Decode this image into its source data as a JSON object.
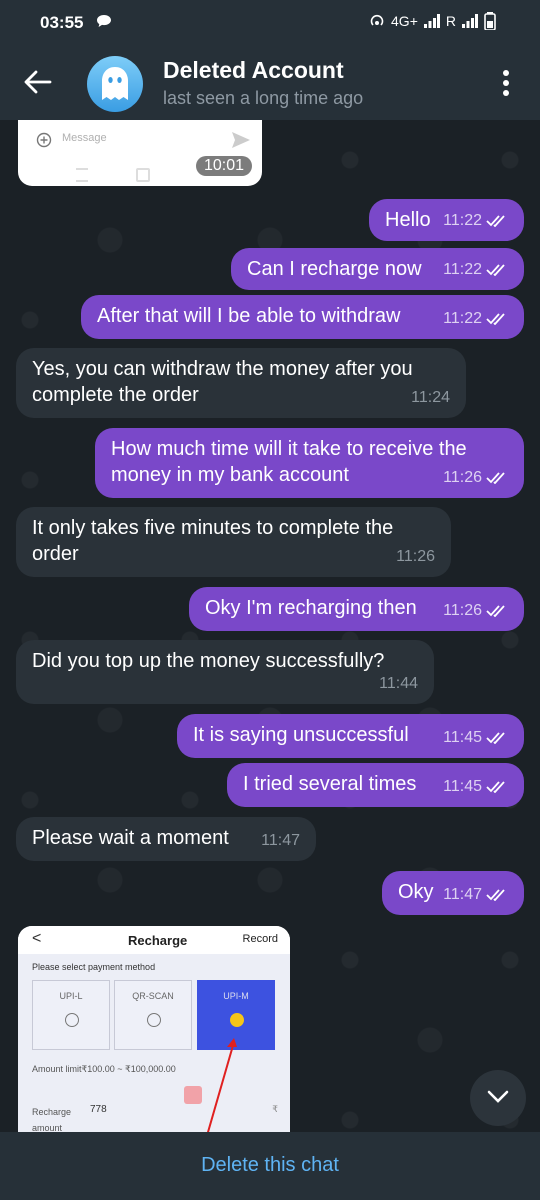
{
  "status_bar": {
    "time": "03:55",
    "network": "4G+",
    "roaming": "R"
  },
  "header": {
    "name": "Deleted Account",
    "status": "last seen a long time ago"
  },
  "image_top": {
    "placeholder": "Message",
    "time": "10:01"
  },
  "messages": [
    {
      "dir": "out",
      "text": "Hello",
      "time": "11:22"
    },
    {
      "dir": "out",
      "text": "Can I recharge now",
      "time": "11:22"
    },
    {
      "dir": "out",
      "text": "After that will I be able to withdraw",
      "time": "11:22"
    },
    {
      "dir": "in",
      "lines": [
        "Yes, you can withdraw the money after you",
        "complete the order"
      ],
      "time": "11:24"
    },
    {
      "dir": "out",
      "lines": [
        "How much time will it take to receive the",
        "money in my bank account"
      ],
      "time": "11:26"
    },
    {
      "dir": "in",
      "lines": [
        "It only takes five minutes to complete the",
        "order"
      ],
      "time": "11:26"
    },
    {
      "dir": "out",
      "text": "Oky I'm recharging then",
      "time": "11:26"
    },
    {
      "dir": "in",
      "text": "Did you top up the money successfully?",
      "time": "11:44"
    },
    {
      "dir": "out",
      "text": "It is saying unsuccessful",
      "time": "11:45"
    },
    {
      "dir": "out",
      "text": "I tried several times",
      "time": "11:45"
    },
    {
      "dir": "in",
      "text": "Please wait a moment",
      "time": "11:47"
    },
    {
      "dir": "out",
      "text": "Oky",
      "time": "11:47"
    }
  ],
  "screenshot": {
    "back": "<",
    "title": "Recharge",
    "record": "Record",
    "select_label": "Please select payment method",
    "options": [
      "UPI-L",
      "QR-SCAN",
      "UPI-M"
    ],
    "selected_option": "UPI-M",
    "limit": "Amount limit₹100.00 ~ ₹100,000.00",
    "recharge_label": "Recharge amount",
    "recharge_value": "778",
    "rupee": "₹"
  },
  "footer": {
    "action": "Delete this chat"
  },
  "colors": {
    "outgoing": "#7a48c9",
    "incoming": "#2a3239",
    "link": "#5fb3f3"
  }
}
